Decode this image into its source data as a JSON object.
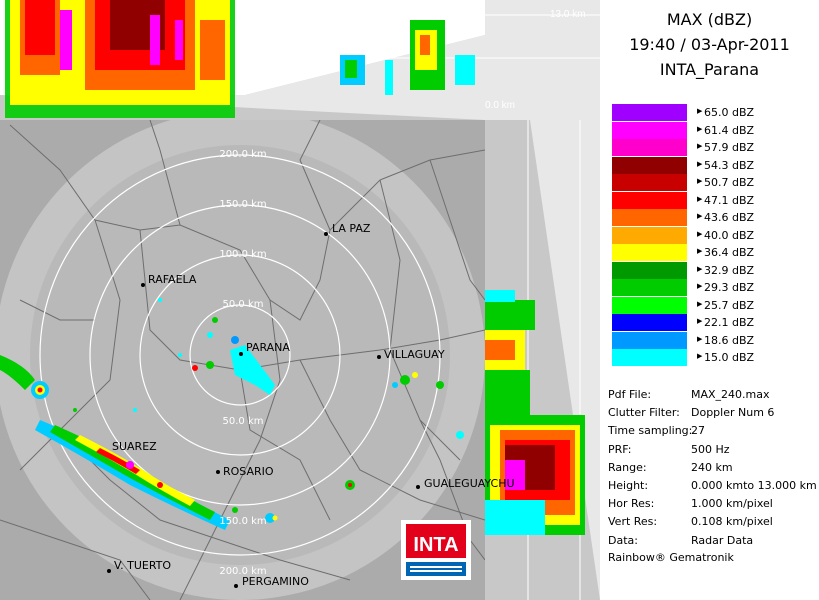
{
  "header": {
    "product": "MAX (dBZ)",
    "datetime": "19:40 / 03-Apr-2011",
    "site": "INTA_Parana"
  },
  "top_panel": {
    "height_top_label": "13.0 km",
    "height_bottom_label": "0.0 km"
  },
  "rings": [
    "50.0 km",
    "100.0 km",
    "150.0 km",
    "200.0 km"
  ],
  "cities": [
    "PARANA",
    "LA PAZ",
    "RAFAELA",
    "VILLAGUAY",
    "ROSARIO",
    "GUALEGUAYCHU",
    "V. TUERTO",
    "PERGAMINO",
    "SUAREZ"
  ],
  "logo": {
    "text": "INTA"
  },
  "legend": [
    {
      "label": "65.0 dBZ",
      "color": "#a000ff"
    },
    {
      "label": "61.4 dBZ",
      "color": "#ff00ff"
    },
    {
      "label": "57.9 dBZ",
      "color": "#ff00cc"
    },
    {
      "label": "54.3 dBZ",
      "color": "#900000"
    },
    {
      "label": "50.7 dBZ",
      "color": "#c80000"
    },
    {
      "label": "47.1 dBZ",
      "color": "#ff0000"
    },
    {
      "label": "43.6 dBZ",
      "color": "#ff6600"
    },
    {
      "label": "40.0 dBZ",
      "color": "#ffaa00"
    },
    {
      "label": "36.4 dBZ",
      "color": "#ffff00"
    },
    {
      "label": "32.9 dBZ",
      "color": "#009900"
    },
    {
      "label": "29.3 dBZ",
      "color": "#00cc00"
    },
    {
      "label": "25.7 dBZ",
      "color": "#00ff00"
    },
    {
      "label": "22.1 dBZ",
      "color": "#0000ff"
    },
    {
      "label": "18.6 dBZ",
      "color": "#0099ff"
    },
    {
      "label": "15.0 dBZ",
      "color": "#00ffff"
    }
  ],
  "info": [
    {
      "key": "Pdf File:",
      "value": "MAX_240.max"
    },
    {
      "key": "Clutter Filter:",
      "value": "Doppler Num 6"
    },
    {
      "key": "Time sampling:",
      "value": "27"
    },
    {
      "key": "PRF:",
      "value": "500 Hz"
    },
    {
      "key": "Range:",
      "value": "240 km"
    },
    {
      "key": "Height:",
      "value": "0.000 kmto 13.000 km"
    },
    {
      "key": "Hor Res:",
      "value": "1.000 km/pixel"
    },
    {
      "key": "Vert Res:",
      "value": "0.108 km/pixel"
    },
    {
      "key": "Data:",
      "value": "Radar Data"
    }
  ],
  "footer": "Rainbow® Gematronik"
}
